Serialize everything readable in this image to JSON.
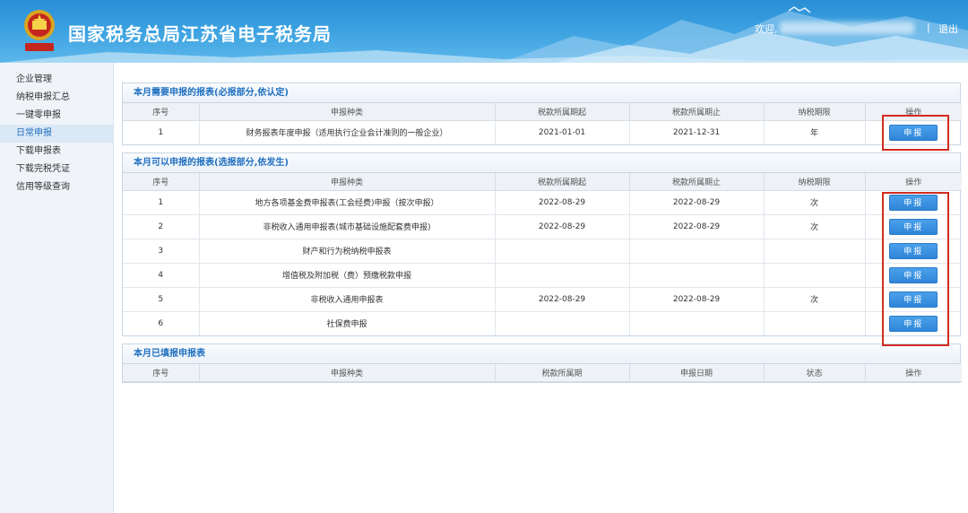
{
  "header": {
    "title": "国家税务总局江苏省电子税务局",
    "welcome": "欢迎,",
    "separator": "|",
    "logout": "退出"
  },
  "sidebar": {
    "items": [
      {
        "label": "企业管理"
      },
      {
        "label": "纳税申报汇总"
      },
      {
        "label": "一键零申报"
      },
      {
        "label": "日常申报"
      },
      {
        "label": "下载申报表"
      },
      {
        "label": "下载完税凭证"
      },
      {
        "label": "信用等级查询"
      }
    ]
  },
  "required_section": {
    "title": "本月需要申报的报表(必报部分,依认定)",
    "headers": [
      "序号",
      "申报种类",
      "税款所属期起",
      "税款所属期止",
      "纳税期限",
      "操作"
    ],
    "rows": [
      {
        "no": "1",
        "type": "财务报表年度申报（适用执行企业会计准则的一般企业）",
        "start": "2021-01-01",
        "end": "2021-12-31",
        "period": "年",
        "action": "申报"
      }
    ]
  },
  "optional_section": {
    "title": "本月可以申报的报表(选报部分,依发生)",
    "headers": [
      "序号",
      "申报种类",
      "税款所属期起",
      "税款所属期止",
      "纳税期限",
      "操作"
    ],
    "rows": [
      {
        "no": "1",
        "type": "地方各项基金费申报表(工会经费)申报（按次申报）",
        "start": "2022-08-29",
        "end": "2022-08-29",
        "period": "次",
        "action": "申报"
      },
      {
        "no": "2",
        "type": "非税收入通用申报表(城市基础设施配套费申报)",
        "start": "2022-08-29",
        "end": "2022-08-29",
        "period": "次",
        "action": "申报"
      },
      {
        "no": "3",
        "type": "财产和行为税纳税申报表",
        "start": "",
        "end": "",
        "period": "",
        "action": "申报"
      },
      {
        "no": "4",
        "type": "增值税及附加税（费）预缴税款申报",
        "start": "",
        "end": "",
        "period": "",
        "action": "申报"
      },
      {
        "no": "5",
        "type": "非税收入通用申报表",
        "start": "2022-08-29",
        "end": "2022-08-29",
        "period": "次",
        "action": "申报"
      },
      {
        "no": "6",
        "type": "社保费申报",
        "start": "",
        "end": "",
        "period": "",
        "action": "申报"
      }
    ]
  },
  "filed_section": {
    "title": "本月已填报申报表",
    "headers": [
      "序号",
      "申报种类",
      "税款所属期",
      "申报日期",
      "状态",
      "操作"
    ]
  },
  "colors": {
    "header_blue": "#2a8fd6",
    "title_blue": "#1f6fbf",
    "button_blue": "#2f86d8",
    "highlight_red": "#d12c1f"
  }
}
